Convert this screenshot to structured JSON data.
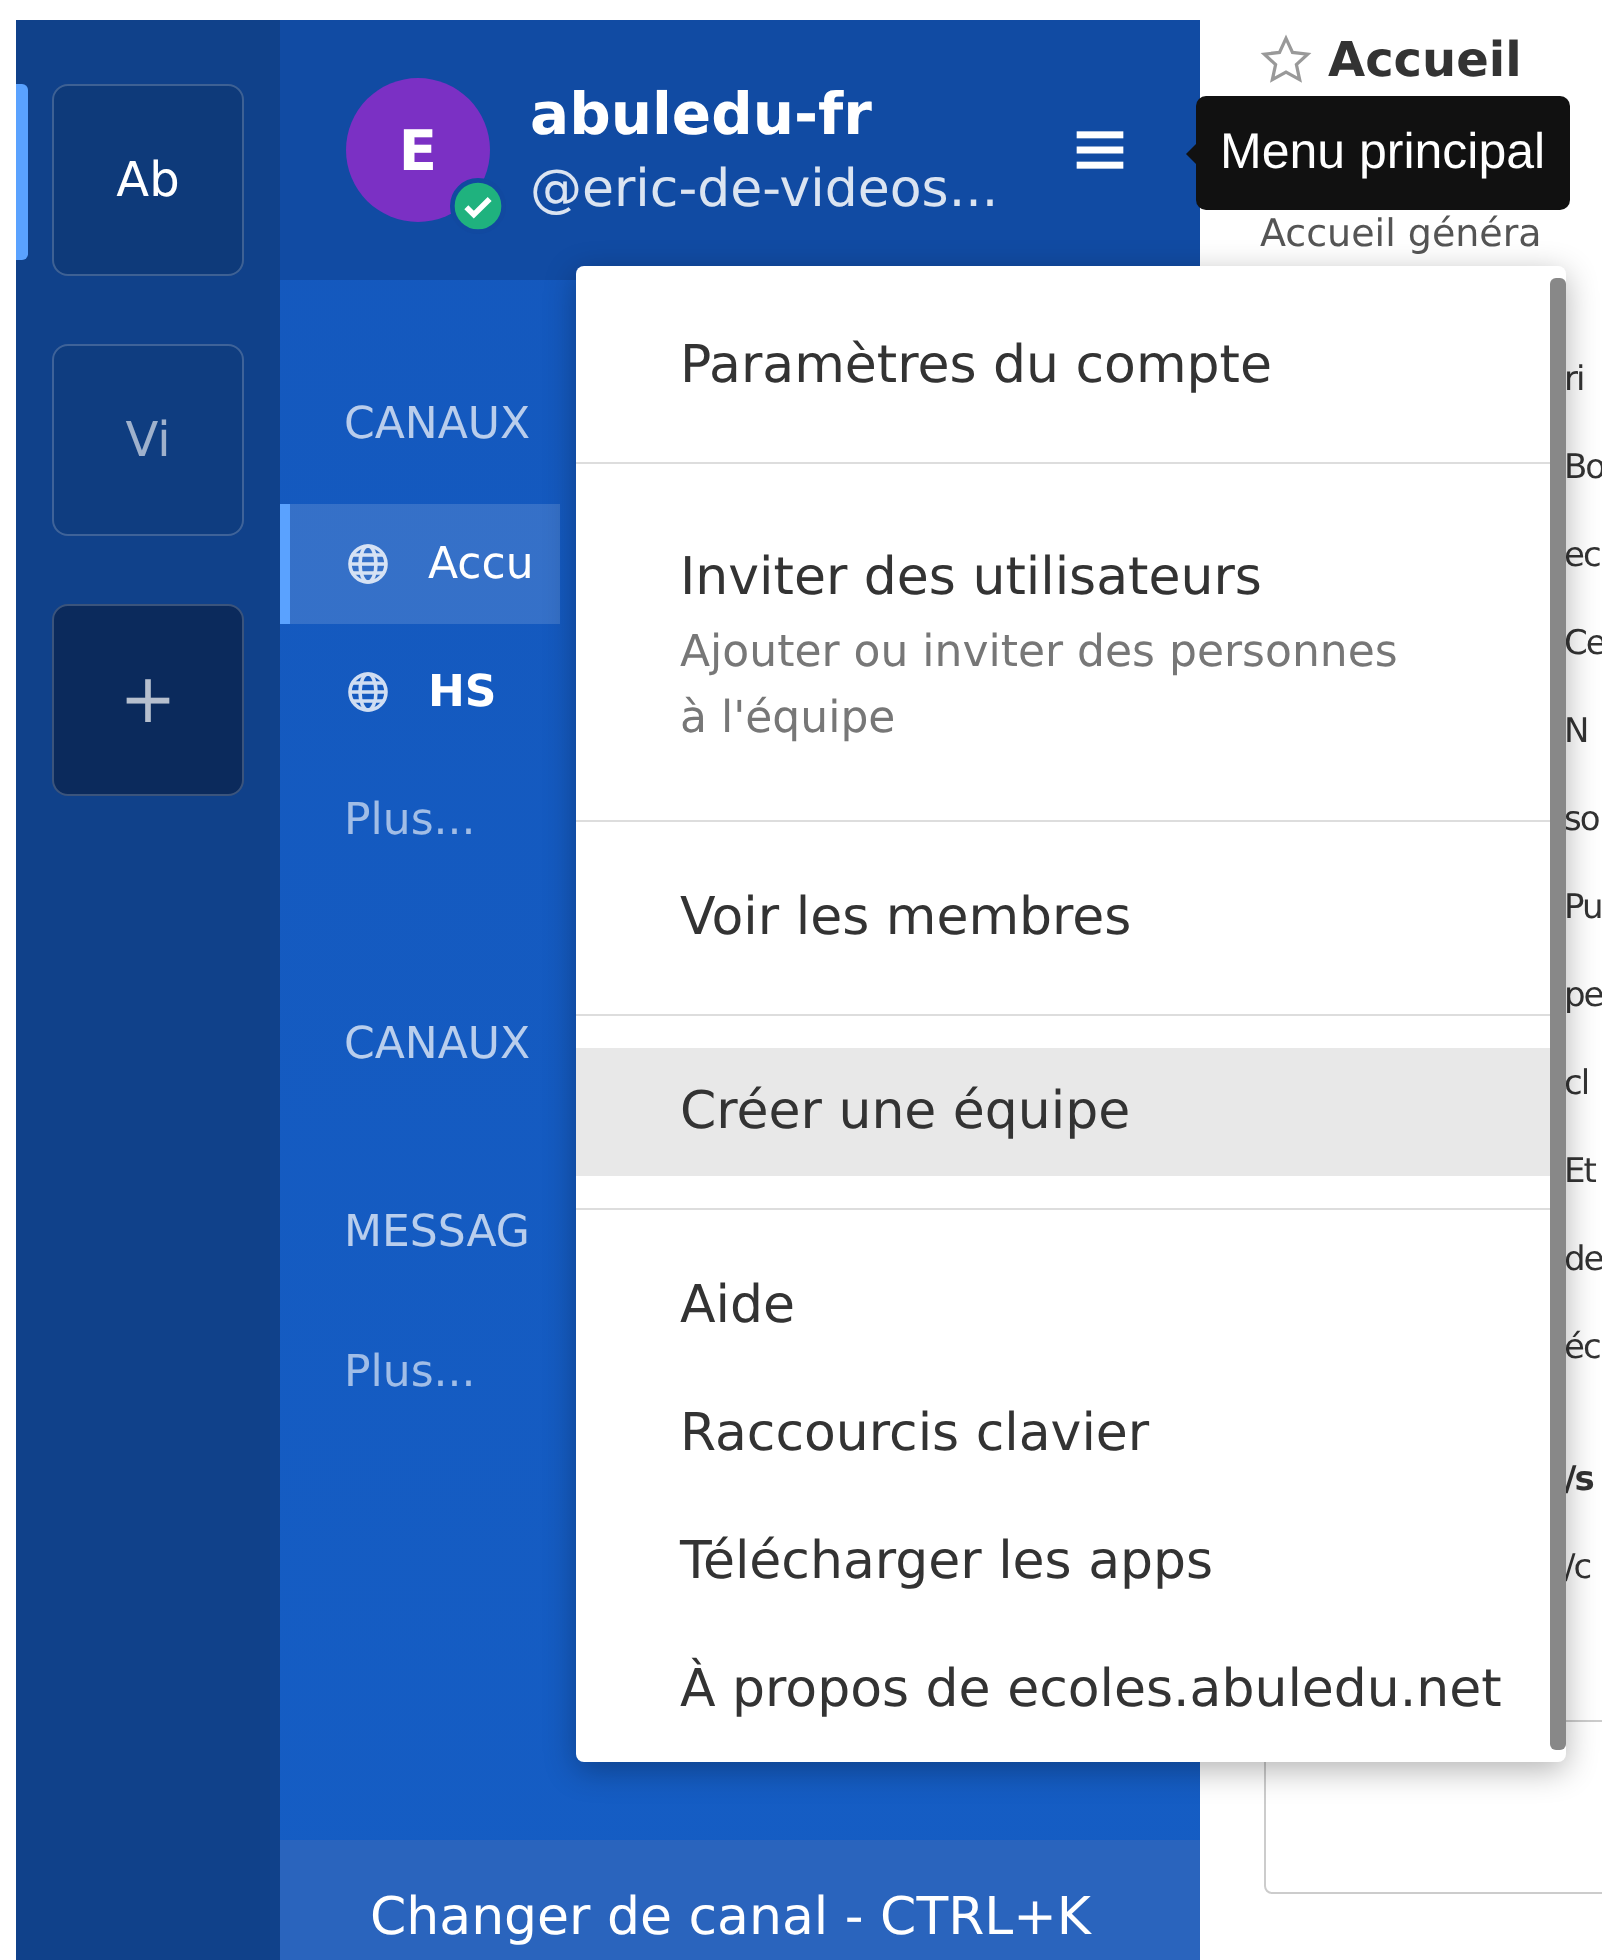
{
  "teams": [
    {
      "label": "Ab",
      "selected": true
    },
    {
      "label": "Vi",
      "selected": false
    }
  ],
  "add_team": "+",
  "user": {
    "avatar_letter": "E",
    "name": "abuledu-fr",
    "handle": "@eric-de-videos...",
    "online": true
  },
  "menu_tooltip": "Menu principal",
  "sidebar": {
    "items": [
      {
        "kind": "header",
        "label": "CANAUX"
      },
      {
        "kind": "channel",
        "label": "Accu",
        "selected": true
      },
      {
        "kind": "channel",
        "label": "HS",
        "selected": false
      },
      {
        "kind": "more",
        "label": "Plus..."
      },
      {
        "kind": "header",
        "label": "CANAUX"
      },
      {
        "kind": "header",
        "label": "MESSAG"
      },
      {
        "kind": "more",
        "label": "Plus..."
      }
    ],
    "switch_channel": "Changer de canal - CTRL+K"
  },
  "main": {
    "title": "Accueil",
    "subtitle": "Accueil généra",
    "fragments": [
      {
        "text": "ri",
        "bold": false
      },
      {
        "text": "Bo",
        "bold": false
      },
      {
        "text": "ec",
        "bold": false
      },
      {
        "text": "Ce",
        "bold": false
      },
      {
        "text": "N",
        "bold": false
      },
      {
        "text": "so",
        "bold": false
      },
      {
        "text": "Pu",
        "bold": false
      },
      {
        "text": "pe",
        "bold": false
      },
      {
        "text": "cl",
        "bold": false
      },
      {
        "text": "Et",
        "bold": false
      },
      {
        "text": "de",
        "bold": false
      },
      {
        "text": "éc",
        "bold": false
      },
      {
        "text": "/s",
        "bold": true
      },
      {
        "text": "/c",
        "bold": false
      }
    ]
  },
  "menu": {
    "groups": [
      [
        {
          "label": "Paramètres du compte",
          "highlighted": false
        }
      ],
      [
        {
          "label": "Inviter des utilisateurs",
          "description": "Ajouter ou inviter des personnes à l'équipe",
          "highlighted": false
        }
      ],
      [
        {
          "label": "Voir les membres",
          "highlighted": false
        }
      ],
      [
        {
          "label": "Créer une équipe",
          "highlighted": true
        }
      ],
      [
        {
          "label": "Aide",
          "highlighted": false
        },
        {
          "label": "Raccourcis clavier",
          "highlighted": false
        },
        {
          "label": "Télécharger les apps",
          "highlighted": false
        },
        {
          "label": "À propos de ecoles.abuledu.net",
          "highlighted": false
        }
      ]
    ]
  }
}
